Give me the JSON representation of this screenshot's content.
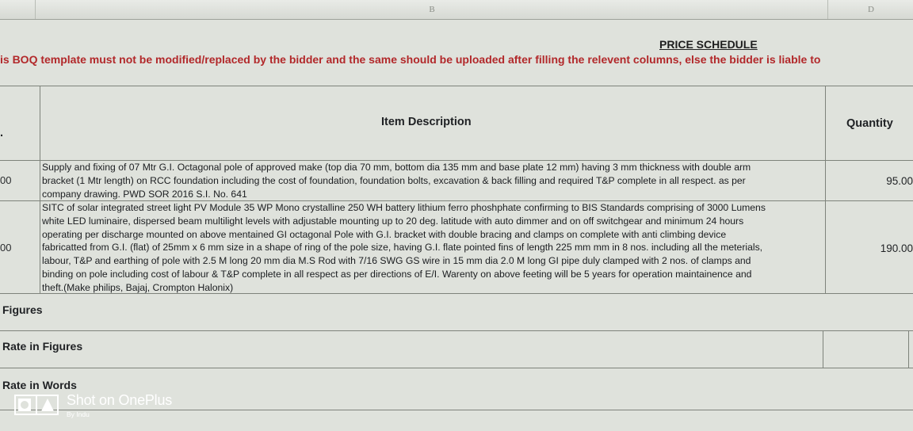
{
  "column_headers": {
    "b": "B",
    "d": "D"
  },
  "title": "PRICE SCHEDULE",
  "warning": "is BOQ template must not be modified/replaced by the bidder and the same should be uploaded after filling the relevent columns, else the bidder is liable to",
  "table": {
    "header": {
      "no_fragment": ".",
      "description": "Item Description",
      "quantity": "Quantity"
    },
    "rows": [
      {
        "num": "00",
        "description": "Supply and fixing of 07 Mtr G.I. Octagonal pole of approved make (top dia 70 mm, bottom dia 135 mm and base plate 12 mm) having 3 mm thickness with double arm\nbracket (1 Mtr length) on RCC foundation including the cost of foundation, foundation bolts, excavation & back filling and required T&P complete in all respect. as per\ncompany drawing. PWD SOR 2016 S.I. No. 641",
        "quantity": "95.00"
      },
      {
        "num": "00",
        "description": "SITC of solar integrated street light PV Module 35 WP Mono crystalline 250 WH battery lithium ferro phoshphate confirming to BIS Standards comprising of 3000 Lumens\nwhite LED luminaire, dispersed beam multilight levels with adjustable mounting up to 20 deg. latitude with auto dimmer and on off switchgear and minimum 24 hours\noperating per discharge mounted on above mentained GI octagonal Pole with G.I. bracket with double bracing and clamps on complete with anti climbing device\nfabricatted from G.I. (flat) of 25mm x 6 mm size in a shape of ring of the pole size, having G.I. flate pointed fins of length 225 mm mm in 8 nos. including all the meterials,\nlabour, T&P and earthing of pole with 2.5 M long 20 mm dia M.S Rod with 7/16 SWG GS wire in 15 mm dia 2.0 M long GI pipe duly clamped with 2 nos. of clamps and\nbinding on pole including cost of labour & T&P complete in all respect as per directions of E/I. Warenty on above feeting will be 5 years for operation maintainence and\ntheft.(Make philips, Bajaj, Crompton Halonix)",
        "quantity": "190.00"
      }
    ],
    "summary": {
      "figures": "Figures",
      "rate_in_figures": "Rate in Figures",
      "rate_in_words": "Rate in Words"
    }
  },
  "watermark": {
    "main": "Shot on OnePlus",
    "sub": "By Indu"
  }
}
